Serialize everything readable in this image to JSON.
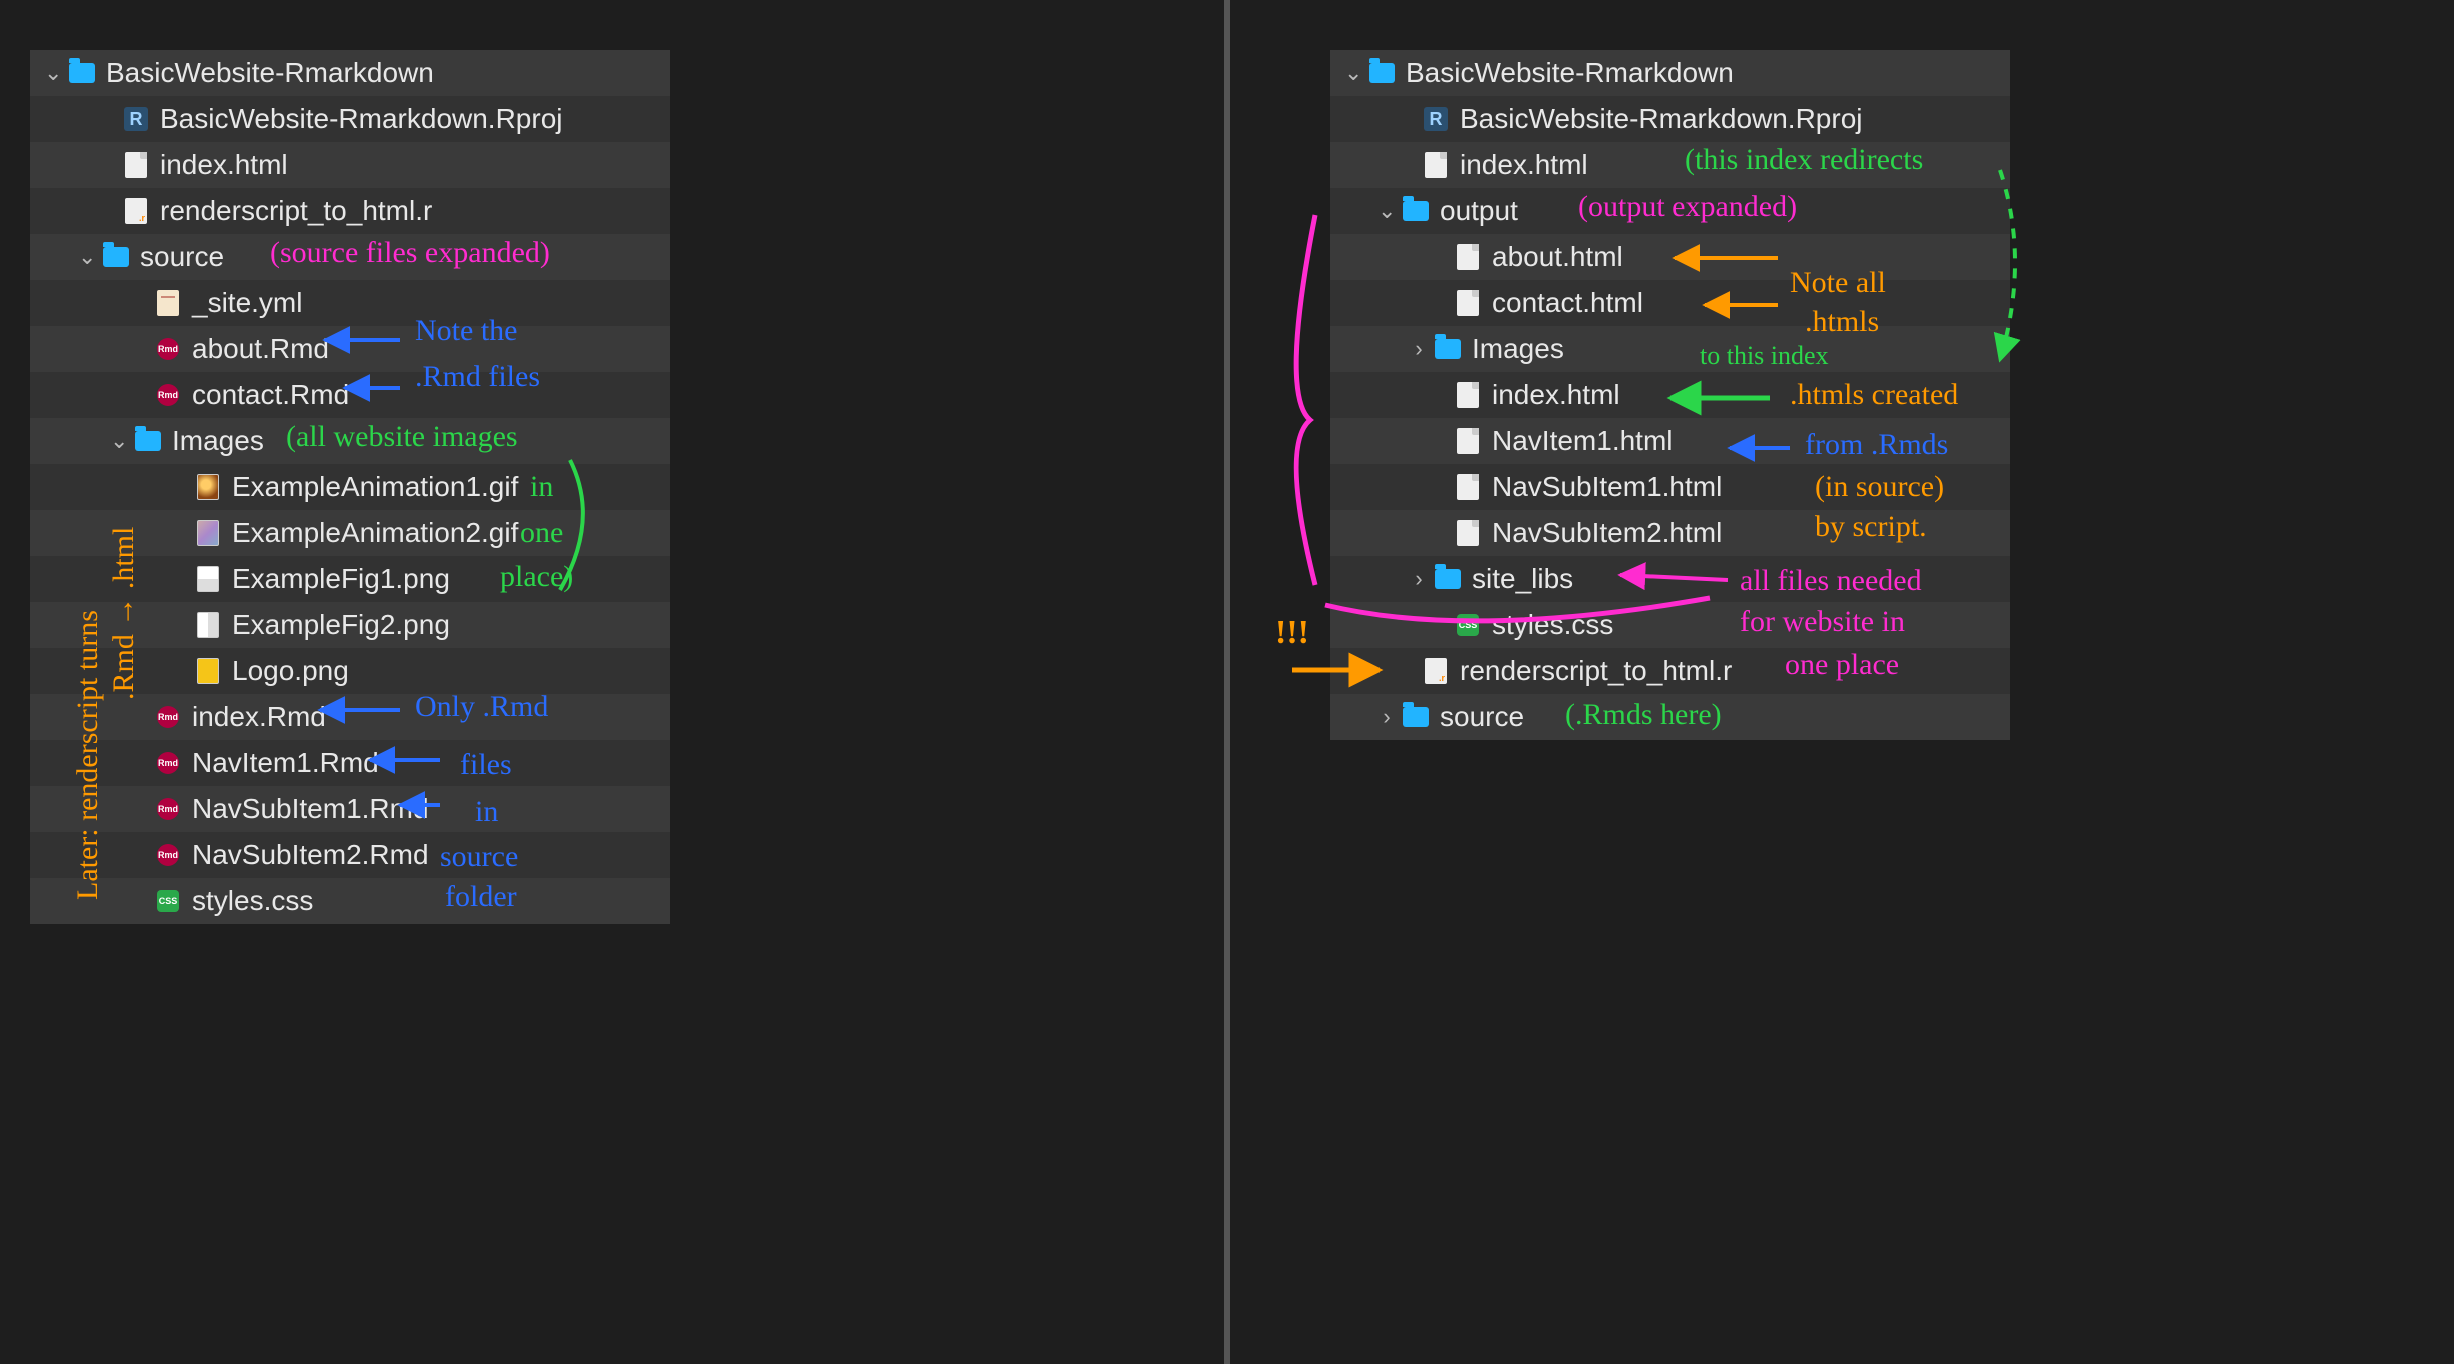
{
  "left": {
    "root": "BasicWebsite-Rmarkdown",
    "items": {
      "rproj": "BasicWebsite-Rmarkdown.Rproj",
      "indexhtml": "index.html",
      "renderscript": "renderscript_to_html.r",
      "source": "source",
      "siteyml": "_site.yml",
      "about": "about.Rmd",
      "contact": "contact.Rmd",
      "images": "Images",
      "ex1": "ExampleAnimation1.gif",
      "ex2": "ExampleAnimation2.gif",
      "fig1": "ExampleFig1.png",
      "fig2": "ExampleFig2.png",
      "logo": "Logo.png",
      "indexrmd": "index.Rmd",
      "nav1": "NavItem1.Rmd",
      "navsub1": "NavSubItem1.Rmd",
      "navsub2": "NavSubItem2.Rmd",
      "styles": "styles.css"
    },
    "ann": {
      "source_expanded": "(source files expanded)",
      "note_rmd1": "Note the",
      "note_rmd2": ".Rmd files",
      "all_images": "(all website images",
      "in_": "in",
      "one": "one",
      "place": "place)",
      "only_rmd": "Only .Rmd",
      "files": "files",
      "in2": "in",
      "source2": "source",
      "folder2": "folder",
      "later1": "Later: renderscript turns",
      "later2": ".Rmd → .html"
    }
  },
  "right": {
    "root": "BasicWebsite-Rmarkdown",
    "items": {
      "rproj": "BasicWebsite-Rmarkdown.Rproj",
      "indexhtml": "index.html",
      "output": "output",
      "about": "about.html",
      "contact": "contact.html",
      "images": "Images",
      "indexhtml2": "index.html",
      "nav1": "NavItem1.html",
      "navsub1": "NavSubItem1.html",
      "navsub2": "NavSubItem2.html",
      "sitelibs": "site_libs",
      "styles": "styles.css",
      "renderscript": "renderscript_to_html.r",
      "source": "source"
    },
    "ann": {
      "redirects": "(this index redirects",
      "output_exp": "(output expanded)",
      "note_all": "Note all",
      "htmls": ".htmls",
      "to_index": "to this index",
      "htmls_created": ".htmls created",
      "from_rmd": "from .Rmds",
      "in_source": "(in source)",
      "by_script": "by script.",
      "all_needed": "all files needed",
      "for_web": "for website in",
      "one_place": "one place",
      "rmds_here": "(.Rmds here)",
      "excl": "!!!"
    }
  }
}
